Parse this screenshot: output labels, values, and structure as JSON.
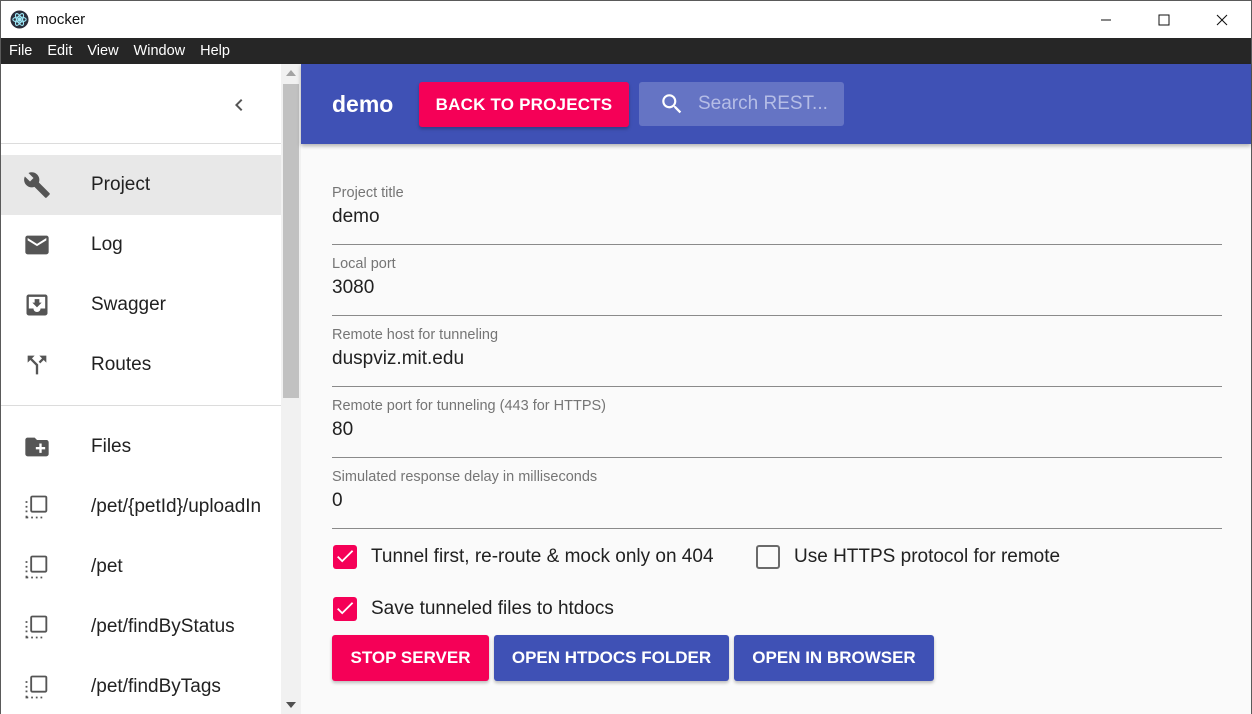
{
  "window": {
    "title": "mocker",
    "controls": {
      "minimize": "minimize-icon",
      "maximize": "maximize-icon",
      "close": "close-icon"
    }
  },
  "menu": [
    "File",
    "Edit",
    "View",
    "Window",
    "Help"
  ],
  "sidebar": {
    "nav": [
      {
        "label": "Project",
        "icon": "wrench-icon",
        "active": true
      },
      {
        "label": "Log",
        "icon": "mail-icon"
      },
      {
        "label": "Swagger",
        "icon": "download-box-icon"
      },
      {
        "label": "Routes",
        "icon": "call-split-icon"
      }
    ],
    "files_label": "Files",
    "files": [
      {
        "label": "/pet/{petId}/uploadIn"
      },
      {
        "label": "/pet"
      },
      {
        "label": "/pet/findByStatus"
      },
      {
        "label": "/pet/findByTags"
      }
    ]
  },
  "header": {
    "project_name": "demo",
    "back_button": "BACK TO PROJECTS",
    "search_placeholder": "Search REST..."
  },
  "form": {
    "fields": [
      {
        "label": "Project title",
        "value": "demo"
      },
      {
        "label": "Local port",
        "value": "3080"
      },
      {
        "label": "Remote host for tunneling",
        "value": "duspviz.mit.edu"
      },
      {
        "label": "Remote port for tunneling (443 for HTTPS)",
        "value": "80"
      },
      {
        "label": "Simulated response delay in milliseconds",
        "value": "0"
      }
    ],
    "checkboxes": [
      {
        "label": "Tunnel first, re-route & mock only on 404",
        "checked": true
      },
      {
        "label": "Use HTTPS protocol for remote",
        "checked": false
      },
      {
        "label": "Save tunneled files to htdocs",
        "checked": true
      }
    ]
  },
  "actions": {
    "stop_server": "STOP SERVER",
    "open_htdocs": "OPEN HTDOCS FOLDER",
    "open_browser": "OPEN IN BROWSER"
  },
  "colors": {
    "primary": "#3f51b5",
    "accent": "#f50057",
    "menubar": "#262626"
  }
}
